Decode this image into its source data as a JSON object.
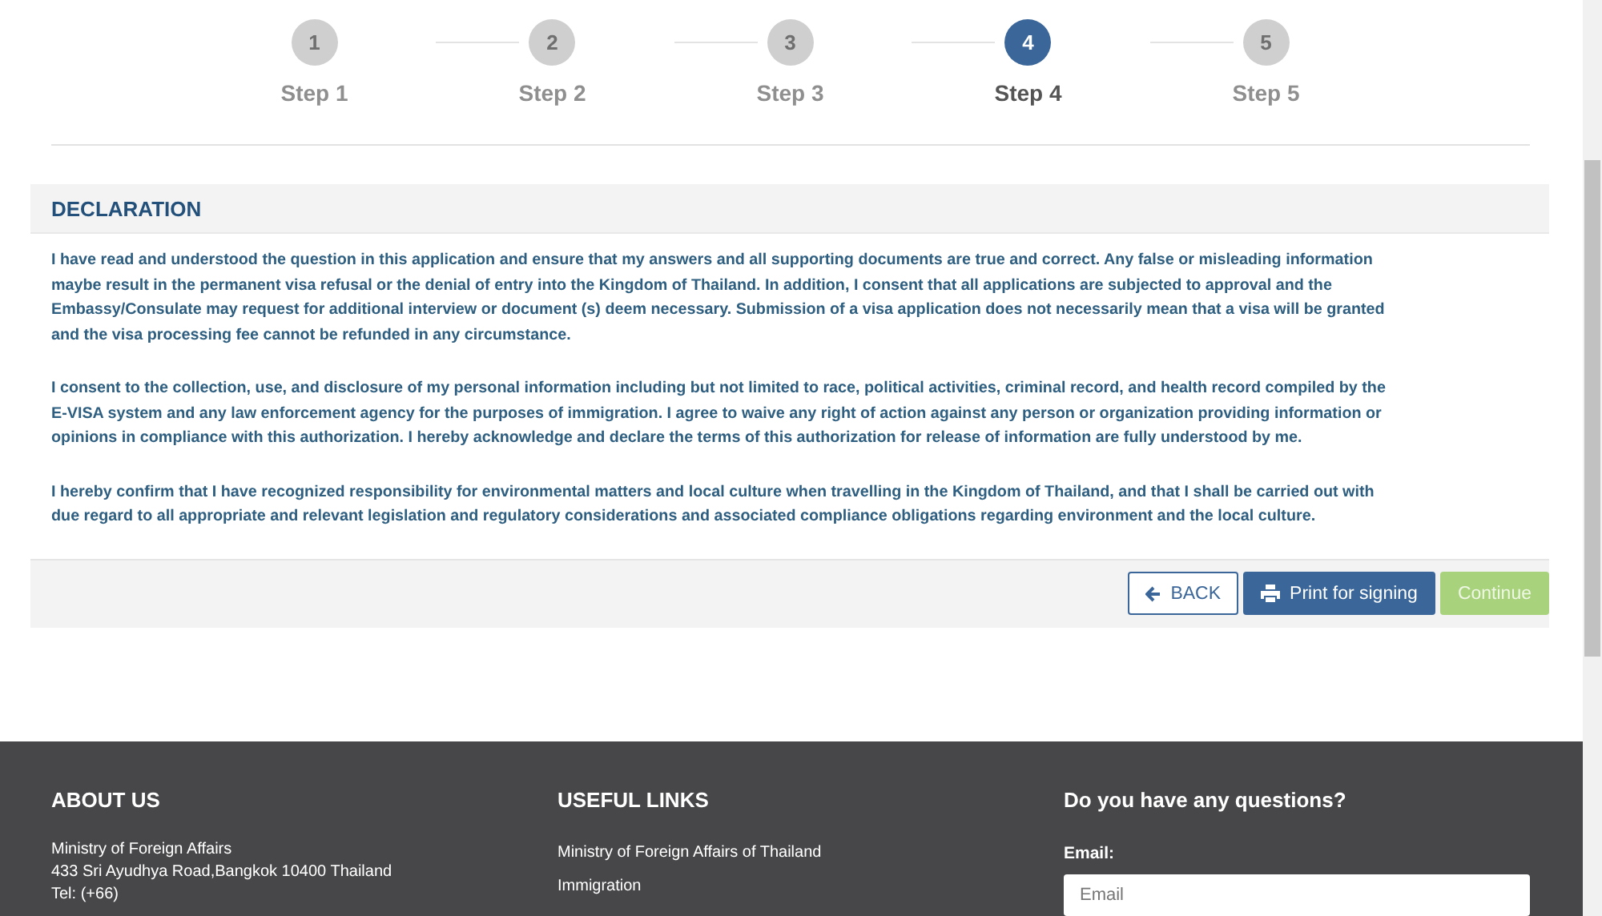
{
  "steps": [
    {
      "number": "1",
      "label": "Step 1",
      "selected": false
    },
    {
      "number": "2",
      "label": "Step 2",
      "selected": false
    },
    {
      "number": "3",
      "label": "Step 3",
      "selected": false
    },
    {
      "number": "4",
      "label": "Step 4",
      "selected": true
    },
    {
      "number": "5",
      "label": "Step 5",
      "selected": false
    }
  ],
  "declaration": {
    "title": "DECLARATION",
    "paragraphs": [
      "I have read and understood the question in this application and ensure that my answers and all supporting documents are true and correct. Any false or misleading information maybe result in the permanent visa refusal or the denial of entry into the Kingdom of Thailand. In addition, I consent that all applications are subjected to approval and the Embassy/Consulate may request for additional interview or document (s) deem necessary. Submission of a visa application does not necessarily mean that a visa will be granted and the visa processing fee cannot be refunded in any circumstance.",
      "I consent to the collection, use, and disclosure of my personal information including but not limited to race, political activities, criminal record, and health record compiled by the E-VISA system and any law enforcement agency for the purposes of immigration. I agree to waive any right of action against any person or organization providing information or opinions in compliance with this authorization. I hereby acknowledge and declare the terms of this authorization for release of information are fully understood by me.",
      "I hereby confirm that I have recognized responsibility for environmental matters and local culture when travelling in the Kingdom of Thailand, and that I shall be carried out with due regard to all appropriate and relevant legislation and regulatory considerations and associated compliance obligations regarding environment and the local culture."
    ]
  },
  "buttons": [
    {
      "kind": "back",
      "label": "BACK"
    },
    {
      "kind": "print",
      "label": "Print for signing"
    },
    {
      "kind": "continue",
      "label": "Continue"
    }
  ],
  "footer": {
    "about": {
      "title": "ABOUT US",
      "lines": [
        "Ministry of Foreign Affairs",
        "433 Sri Ayudhya Road,Bangkok 10400 Thailand",
        "Tel: (+66)"
      ]
    },
    "links": {
      "title": "USEFUL LINKS",
      "items": [
        "Ministry of Foreign Affairs of Thailand",
        "Immigration"
      ]
    },
    "questions": {
      "title": "Do you have any questions?",
      "email_label": "Email:",
      "email_placeholder": "Email"
    }
  }
}
